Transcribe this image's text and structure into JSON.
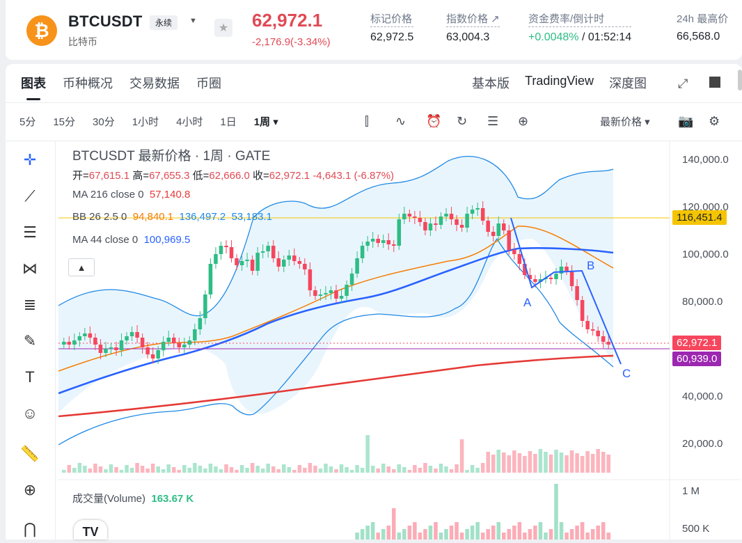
{
  "header": {
    "pair": "BTCUSDT",
    "badge": "永续",
    "sub": "比特币",
    "coin_symbol": "₿",
    "price": "62,972.1",
    "change": "-2,176.9(-3.34%)",
    "stats": [
      {
        "label": "标记价格",
        "value": "62,972.5"
      },
      {
        "label": "指数价格 ↗",
        "value": "63,004.3"
      },
      {
        "label": "资金费率/倒计时",
        "value_green": "+0.0048%",
        "value": " / 01:52:14"
      },
      {
        "label": "24h 最高价",
        "value": "66,568.0"
      }
    ]
  },
  "tabs": [
    "图表",
    "币种概况",
    "交易数据",
    "币圈"
  ],
  "view_tabs": [
    "基本版",
    "TradingView",
    "深度图"
  ],
  "timeframes": [
    "5分",
    "15分",
    "30分",
    "1小时",
    "4小时",
    "1日",
    "1周 ▾"
  ],
  "price_type": "最新价格 ▾",
  "legend": {
    "title": "BTCUSDT 最新价格 · 1周 · GATE",
    "ohlc_open_lbl": "开=",
    "ohlc_open": "67,615.1",
    "ohlc_high_lbl": "高=",
    "ohlc_high": "67,655.3",
    "ohlc_low_lbl": "低=",
    "ohlc_low": "62,666.0",
    "ohlc_close_lbl": "收=",
    "ohlc_close": "62,972.1",
    "ohlc_change": "-4,643.1 (-6.87%)",
    "ma216_lbl": "MA 216 close 0",
    "ma216_val": "57,140.8",
    "bb_lbl": "BB 26 2.5 0",
    "bb_mid": "94,840.1",
    "bb_up": "136,497.2",
    "bb_low": "53,183.1",
    "ma44_lbl": "MA 44 close 0",
    "ma44_val": "100,969.5"
  },
  "axis": [
    "140,000.0",
    "120,000.0",
    "100,000.0",
    "80,000.0",
    "40,000.0",
    "20,000.0"
  ],
  "price_tags": {
    "hline": "116,451.4",
    "last": "62,972.1",
    "ma": "60,939.0"
  },
  "volume": {
    "label": "成交量(Volume)",
    "value": "163.67 K",
    "axis": [
      "1 M",
      "500 K"
    ]
  },
  "annotations": [
    "A",
    "B",
    "C"
  ],
  "colors": {
    "up": "#2ebd85",
    "down": "#f6465d",
    "ma44": "#2962ff",
    "ma216": "#e53935",
    "bb_mid": "#f57c00",
    "bb_band": "#1e88e5",
    "hline": "#f5c400"
  },
  "chart_data": {
    "type": "candlestick",
    "timeframe": "1周",
    "yaxis_ticks": [
      140000,
      120000,
      100000,
      80000,
      40000,
      20000
    ],
    "last_ohlc": {
      "open": 67615.1,
      "high": 67655.3,
      "low": 62666.0,
      "close": 62972.1
    },
    "indicators": {
      "MA216": 57140.8,
      "BB_mid": 94840.1,
      "BB_upper": 136497.2,
      "BB_lower": 53183.1,
      "MA44": 100969.5
    },
    "horizontal_line": 116451.4,
    "volume_last": "163.67 K"
  }
}
